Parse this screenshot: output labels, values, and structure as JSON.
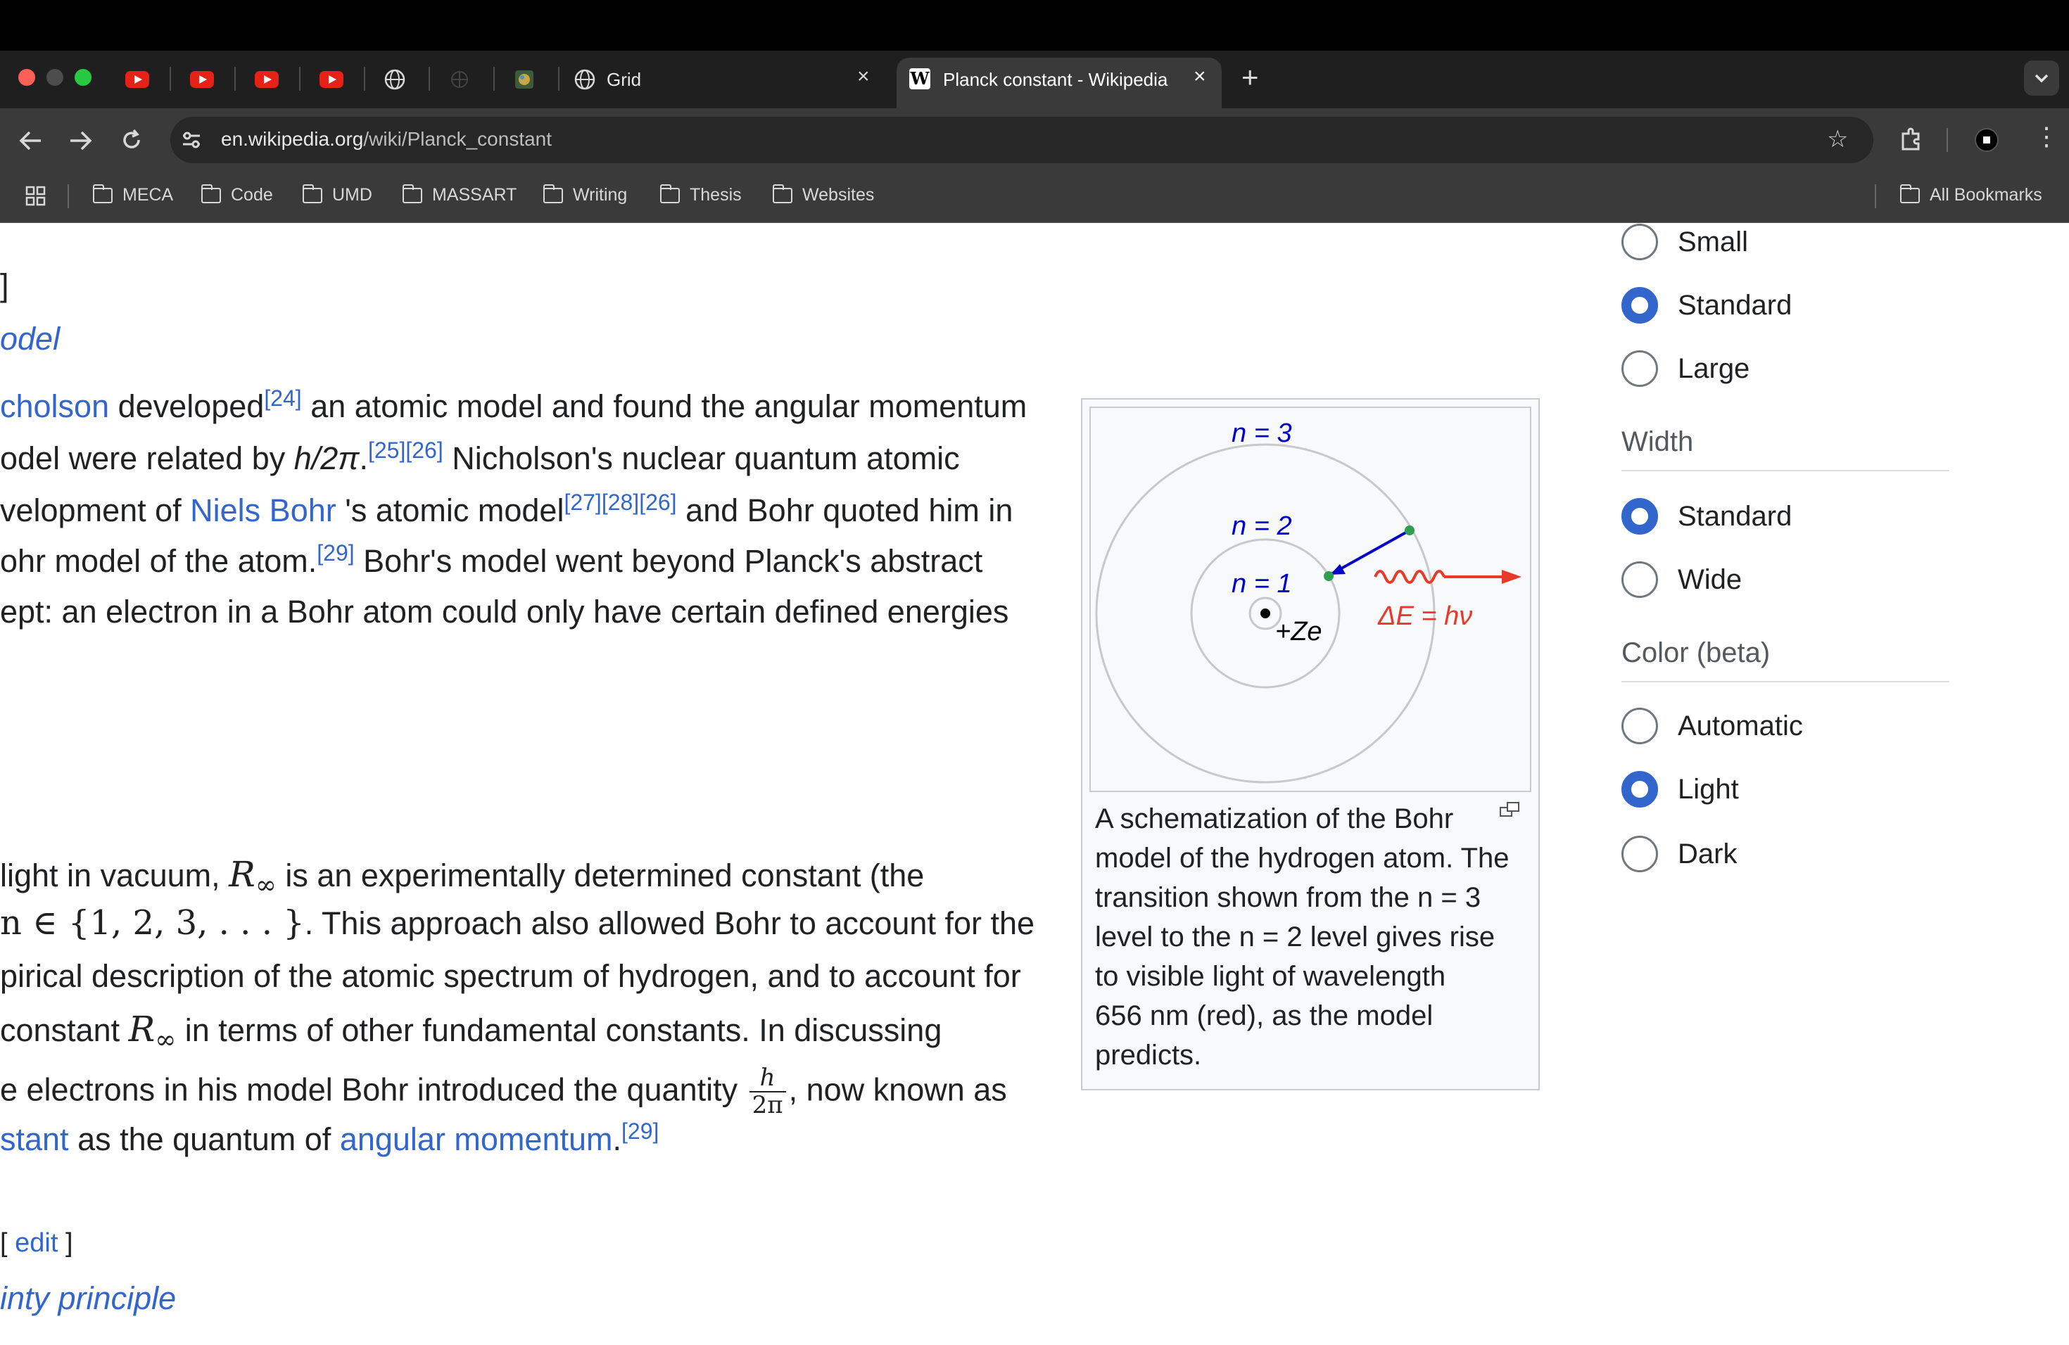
{
  "browser": {
    "tabs": [
      {
        "icon": "youtube-icon"
      },
      {
        "icon": "youtube-icon"
      },
      {
        "icon": "youtube-icon"
      },
      {
        "icon": "youtube-icon"
      },
      {
        "icon": "globe-icon"
      },
      {
        "icon": "generic-favicon-icon"
      },
      {
        "icon": "image-favicon-icon"
      },
      {
        "title": "Grid",
        "icon": "globe-icon"
      },
      {
        "title": "Planck constant - Wikipedia",
        "icon": "wikipedia-icon",
        "active": true
      }
    ],
    "url_host": "en.wikipedia.org",
    "url_path": "/wiki/Planck_constant",
    "bookmarks": [
      "MECA",
      "Code",
      "UMD",
      "MASSART",
      "Writing",
      "Thesis",
      "Websites"
    ],
    "all_bookmarks": "All Bookmarks"
  },
  "article": {
    "top_bracket": "]",
    "heading_model": "odel",
    "p1": {
      "l1_link": "cholson",
      "l1_text": " developed",
      "l1_ref": "[24]",
      "l1_rest": " an atomic model and found the angular momentum",
      "l2_pre": "odel were related by ",
      "l2_math": "h/2π",
      "l2_dot": ".",
      "l2_refs": "[25][26]",
      "l2_rest": " Nicholson's nuclear quantum atomic",
      "l3_pre": "velopment of ",
      "l3_link": "Niels Bohr",
      "l3_mid": " 's atomic model",
      "l3_refs": "[27][28][26]",
      "l3_rest": " and Bohr quoted him in",
      "l4_pre": "ohr model of the atom.",
      "l4_ref": "[29]",
      "l4_rest": " Bohr's model went beyond Planck's abstract",
      "l5": "ept: an electron in a Bohr atom could only have certain defined energies"
    },
    "p2": {
      "l1_pre": "light in vacuum, ",
      "l1_math": "R",
      "l1_sub": "∞",
      "l1_rest": " is an experimentally determined constant (the",
      "l2_math": "n ∈ {1, 2, 3, . . . }",
      "l2_rest": ". This approach also allowed Bohr to account for the",
      "l3": "pirical description of the atomic spectrum of hydrogen, and to account for",
      "l4_pre": "constant ",
      "l4_math": "R",
      "l4_sub": "∞",
      "l4_rest": " in terms of other fundamental constants. In discussing",
      "l5_pre": "e electrons in his model Bohr introduced the quantity ",
      "l5_num": "h",
      "l5_den": "2π",
      "l5_rest": ", now known as",
      "l6_link": "stant",
      "l6_mid": " as the quantum of ",
      "l6_link2": "angular momentum",
      "l6_dot": ".",
      "l6_ref": "[29]"
    },
    "edit_open": "[ ",
    "edit_link": "edit",
    "edit_close": " ]",
    "heading_uncertainty": "inty principle"
  },
  "figure": {
    "labels": {
      "n3": "n = 3",
      "n2": "n = 2",
      "n1": "n = 1",
      "nucleus": "+Ze",
      "energy": "ΔE = hν"
    },
    "caption_lines": [
      "A schematization of the Bohr",
      "model of the hydrogen atom. The",
      "transition shown from the n = 3",
      "level to the n = 2 level gives rise",
      "to visible light of wavelength",
      "656 nm (red), as the model",
      "predicts."
    ],
    "enlarge_icon": "enlarge-icon"
  },
  "appearance": {
    "text_options": [
      {
        "label": "Small",
        "selected": false
      },
      {
        "label": "Standard",
        "selected": true
      },
      {
        "label": "Large",
        "selected": false
      }
    ],
    "width_heading": "Width",
    "width_options": [
      {
        "label": "Standard",
        "selected": true
      },
      {
        "label": "Wide",
        "selected": false
      }
    ],
    "color_heading": "Color (beta)",
    "color_options": [
      {
        "label": "Automatic",
        "selected": false
      },
      {
        "label": "Light",
        "selected": true
      },
      {
        "label": "Dark",
        "selected": false
      }
    ]
  },
  "colors": {
    "link": "#3366cc",
    "radio_selected": "#3366cc",
    "photon": "#e8392b",
    "electron_arrow": "#0000cc"
  }
}
